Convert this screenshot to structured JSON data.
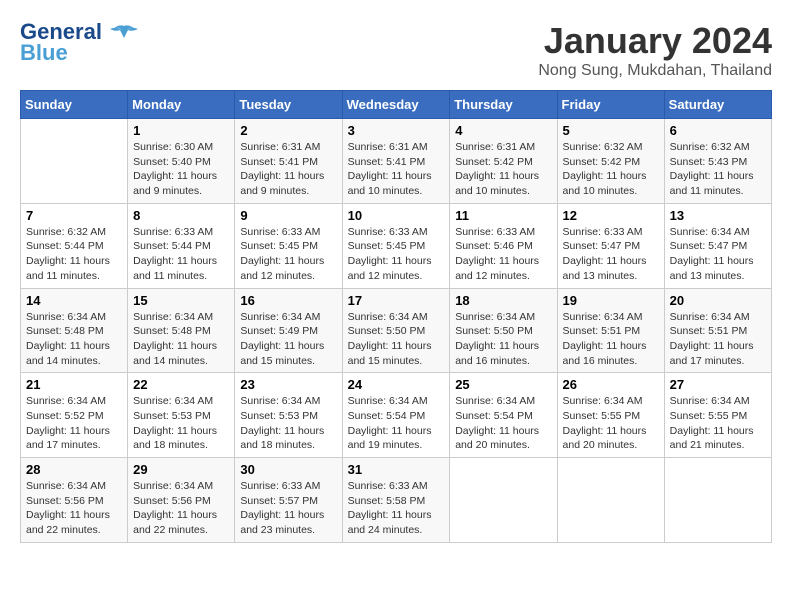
{
  "header": {
    "logo_line1": "General",
    "logo_line2": "Blue",
    "month_title": "January 2024",
    "location": "Nong Sung, Mukdahan, Thailand"
  },
  "weekdays": [
    "Sunday",
    "Monday",
    "Tuesday",
    "Wednesday",
    "Thursday",
    "Friday",
    "Saturday"
  ],
  "weeks": [
    [
      {
        "day": "",
        "info": ""
      },
      {
        "day": "1",
        "info": "Sunrise: 6:30 AM\nSunset: 5:40 PM\nDaylight: 11 hours\nand 9 minutes."
      },
      {
        "day": "2",
        "info": "Sunrise: 6:31 AM\nSunset: 5:41 PM\nDaylight: 11 hours\nand 9 minutes."
      },
      {
        "day": "3",
        "info": "Sunrise: 6:31 AM\nSunset: 5:41 PM\nDaylight: 11 hours\nand 10 minutes."
      },
      {
        "day": "4",
        "info": "Sunrise: 6:31 AM\nSunset: 5:42 PM\nDaylight: 11 hours\nand 10 minutes."
      },
      {
        "day": "5",
        "info": "Sunrise: 6:32 AM\nSunset: 5:42 PM\nDaylight: 11 hours\nand 10 minutes."
      },
      {
        "day": "6",
        "info": "Sunrise: 6:32 AM\nSunset: 5:43 PM\nDaylight: 11 hours\nand 11 minutes."
      }
    ],
    [
      {
        "day": "7",
        "info": "Sunrise: 6:32 AM\nSunset: 5:44 PM\nDaylight: 11 hours\nand 11 minutes."
      },
      {
        "day": "8",
        "info": "Sunrise: 6:33 AM\nSunset: 5:44 PM\nDaylight: 11 hours\nand 11 minutes."
      },
      {
        "day": "9",
        "info": "Sunrise: 6:33 AM\nSunset: 5:45 PM\nDaylight: 11 hours\nand 12 minutes."
      },
      {
        "day": "10",
        "info": "Sunrise: 6:33 AM\nSunset: 5:45 PM\nDaylight: 11 hours\nand 12 minutes."
      },
      {
        "day": "11",
        "info": "Sunrise: 6:33 AM\nSunset: 5:46 PM\nDaylight: 11 hours\nand 12 minutes."
      },
      {
        "day": "12",
        "info": "Sunrise: 6:33 AM\nSunset: 5:47 PM\nDaylight: 11 hours\nand 13 minutes."
      },
      {
        "day": "13",
        "info": "Sunrise: 6:34 AM\nSunset: 5:47 PM\nDaylight: 11 hours\nand 13 minutes."
      }
    ],
    [
      {
        "day": "14",
        "info": "Sunrise: 6:34 AM\nSunset: 5:48 PM\nDaylight: 11 hours\nand 14 minutes."
      },
      {
        "day": "15",
        "info": "Sunrise: 6:34 AM\nSunset: 5:48 PM\nDaylight: 11 hours\nand 14 minutes."
      },
      {
        "day": "16",
        "info": "Sunrise: 6:34 AM\nSunset: 5:49 PM\nDaylight: 11 hours\nand 15 minutes."
      },
      {
        "day": "17",
        "info": "Sunrise: 6:34 AM\nSunset: 5:50 PM\nDaylight: 11 hours\nand 15 minutes."
      },
      {
        "day": "18",
        "info": "Sunrise: 6:34 AM\nSunset: 5:50 PM\nDaylight: 11 hours\nand 16 minutes."
      },
      {
        "day": "19",
        "info": "Sunrise: 6:34 AM\nSunset: 5:51 PM\nDaylight: 11 hours\nand 16 minutes."
      },
      {
        "day": "20",
        "info": "Sunrise: 6:34 AM\nSunset: 5:51 PM\nDaylight: 11 hours\nand 17 minutes."
      }
    ],
    [
      {
        "day": "21",
        "info": "Sunrise: 6:34 AM\nSunset: 5:52 PM\nDaylight: 11 hours\nand 17 minutes."
      },
      {
        "day": "22",
        "info": "Sunrise: 6:34 AM\nSunset: 5:53 PM\nDaylight: 11 hours\nand 18 minutes."
      },
      {
        "day": "23",
        "info": "Sunrise: 6:34 AM\nSunset: 5:53 PM\nDaylight: 11 hours\nand 18 minutes."
      },
      {
        "day": "24",
        "info": "Sunrise: 6:34 AM\nSunset: 5:54 PM\nDaylight: 11 hours\nand 19 minutes."
      },
      {
        "day": "25",
        "info": "Sunrise: 6:34 AM\nSunset: 5:54 PM\nDaylight: 11 hours\nand 20 minutes."
      },
      {
        "day": "26",
        "info": "Sunrise: 6:34 AM\nSunset: 5:55 PM\nDaylight: 11 hours\nand 20 minutes."
      },
      {
        "day": "27",
        "info": "Sunrise: 6:34 AM\nSunset: 5:55 PM\nDaylight: 11 hours\nand 21 minutes."
      }
    ],
    [
      {
        "day": "28",
        "info": "Sunrise: 6:34 AM\nSunset: 5:56 PM\nDaylight: 11 hours\nand 22 minutes."
      },
      {
        "day": "29",
        "info": "Sunrise: 6:34 AM\nSunset: 5:56 PM\nDaylight: 11 hours\nand 22 minutes."
      },
      {
        "day": "30",
        "info": "Sunrise: 6:33 AM\nSunset: 5:57 PM\nDaylight: 11 hours\nand 23 minutes."
      },
      {
        "day": "31",
        "info": "Sunrise: 6:33 AM\nSunset: 5:58 PM\nDaylight: 11 hours\nand 24 minutes."
      },
      {
        "day": "",
        "info": ""
      },
      {
        "day": "",
        "info": ""
      },
      {
        "day": "",
        "info": ""
      }
    ]
  ]
}
